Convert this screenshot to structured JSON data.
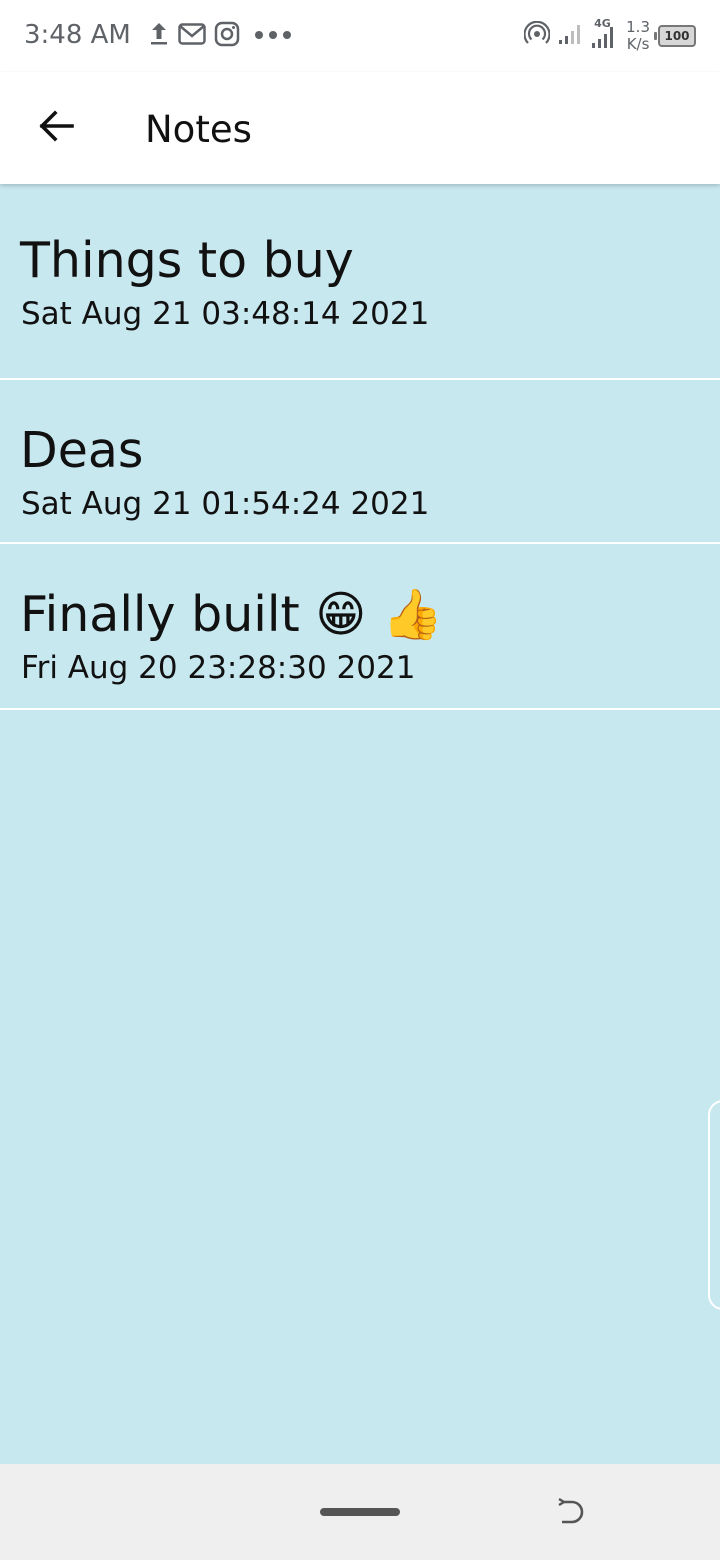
{
  "status_bar": {
    "time": "3:48 AM",
    "left_icons": [
      "upload-icon",
      "gmail-icon",
      "instagram-icon",
      "more-dots-icon"
    ],
    "right_icons": [
      "hotspot-icon",
      "signal-icon",
      "signal-4g-icon"
    ],
    "network_type": "4G",
    "speed_value": "1.3",
    "speed_unit": "K/s",
    "battery": "100"
  },
  "app_bar": {
    "back_icon": "arrow-left-icon",
    "title": "Notes"
  },
  "notes": [
    {
      "title": "Things to buy",
      "date": "Sat Aug 21 03:48:14 2021"
    },
    {
      "title": "Deas",
      "date": "Sat Aug 21 01:54:24 2021"
    },
    {
      "title": "Finally built 😁 👍",
      "date": "Fri Aug 20 23:28:30 2021"
    }
  ],
  "colors": {
    "background": "#c8e8f0",
    "app_bar": "#ffffff",
    "divider": "#ffffff",
    "nav_bar": "#efefef"
  }
}
